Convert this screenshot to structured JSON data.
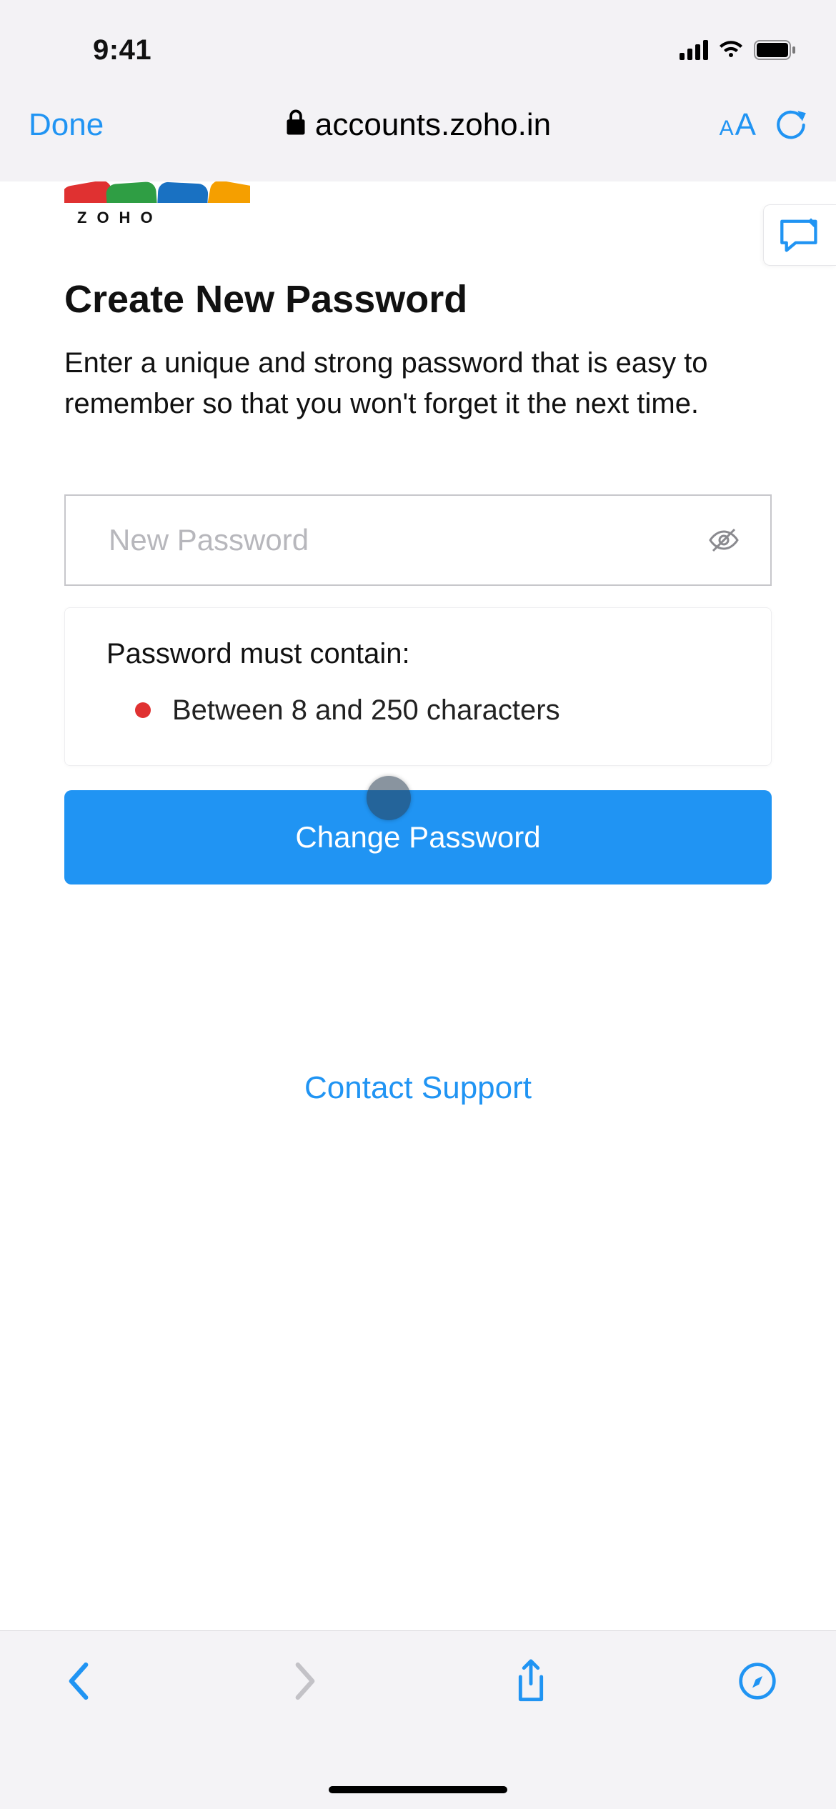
{
  "status": {
    "time": "9:41"
  },
  "browser": {
    "done_label": "Done",
    "url": "accounts.zoho.in"
  },
  "brand": {
    "name": "ZOHO"
  },
  "page": {
    "heading": "Create New Password",
    "subtext": "Enter a unique and strong password that is easy to remember so that you won't forget it the next time."
  },
  "password_field": {
    "placeholder": "New Password",
    "value": ""
  },
  "rules": {
    "title": "Password must contain:",
    "items": [
      {
        "status": "unmet",
        "text": "Between 8 and 250 characters"
      }
    ]
  },
  "primary_button": {
    "label": "Change Password"
  },
  "support_link": {
    "label": "Contact Support"
  }
}
